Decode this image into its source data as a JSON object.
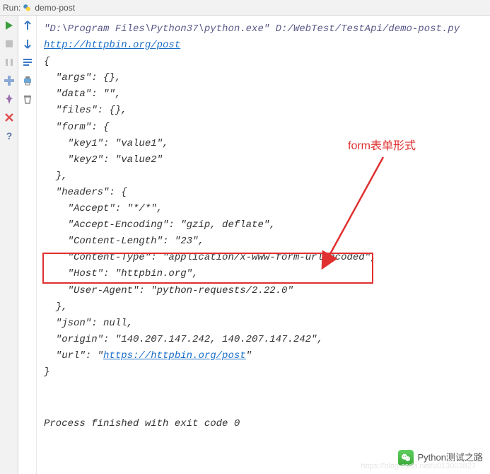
{
  "titlebar": {
    "label": "Run:",
    "tab": "demo-post"
  },
  "toolbar1": {
    "play": "play-icon",
    "stop": "stop-icon",
    "pause": "pause-icon",
    "bookmark": "bookmark-icon",
    "pin": "pin-icon",
    "close": "close-icon",
    "help": "help-icon"
  },
  "toolbar2": {
    "up": "arrow-up-icon",
    "down": "arrow-down-icon",
    "wrap": "wrap-icon",
    "print": "print-icon",
    "trash": "trash-icon"
  },
  "console": {
    "cmd": "\"D:\\Program Files\\Python37\\python.exe\" D:/WebTest/TestApi/demo-post.py",
    "url_link": "http://httpbin.org/post",
    "json_lines": [
      "{",
      "  \"args\": {},",
      "  \"data\": \"\",",
      "  \"files\": {},",
      "  \"form\": {",
      "    \"key1\": \"value1\",",
      "    \"key2\": \"value2\"",
      "  },",
      "  \"headers\": {",
      "    \"Accept\": \"*/*\",",
      "    \"Accept-Encoding\": \"gzip, deflate\",",
      "    \"Content-Length\": \"23\",",
      "    \"Content-Type\": \"application/x-www-form-urlencoded\",",
      "    \"Host\": \"httpbin.org\",",
      "    \"User-Agent\": \"python-requests/2.22.0\"",
      "  },",
      "  \"json\": null,",
      "  \"origin\": \"140.207.147.242, 140.207.147.242\",",
      "  \"url\": \""
    ],
    "url2_link": "https://httpbin.org/post",
    "json_tail": [
      "\"",
      "}"
    ],
    "footer": "Process finished with exit code 0"
  },
  "annotation": {
    "text": "form表单形式"
  },
  "watermark": {
    "text": "Python测试之路"
  },
  "faint_url": "https://blog.csdn.net/u013003827"
}
